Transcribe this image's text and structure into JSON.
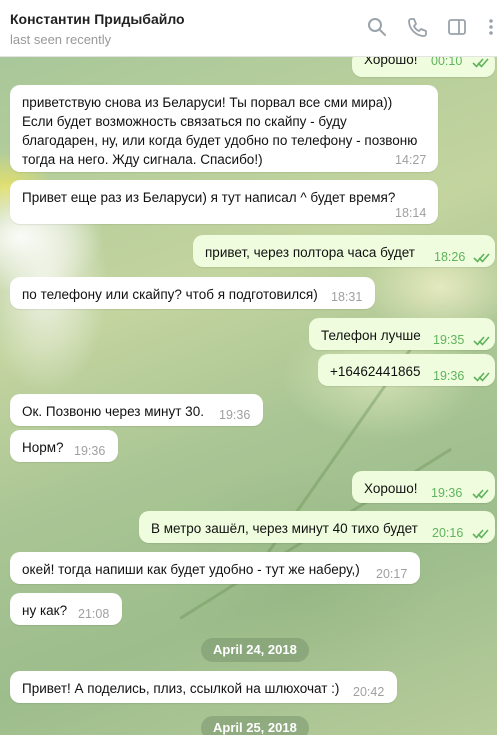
{
  "header": {
    "contact_name": "Константин Придыбайло",
    "last_seen": "last seen recently",
    "icons": [
      "search-icon",
      "phone-icon",
      "sidebar-icon",
      "more-icon"
    ]
  },
  "messages": [
    {
      "dir": "out",
      "text": "Хорошо!",
      "time": "00:10",
      "read": true
    },
    {
      "dir": "in",
      "text": "приветствую снова из Беларуси! Ты порвал все сми мира)) Если будет возможность связаться по скайпу - буду благодарен, ну, или когда будет удобно по телефону - позвоню тогда на него. Жду сигнала. Спасибо!)",
      "time": "14:27"
    },
    {
      "dir": "in",
      "text": "Привет еще раз из Беларуси) я тут написал ^ будет время?",
      "time": "18:14"
    },
    {
      "dir": "out",
      "text": "привет, через полтора часа будет",
      "time": "18:26",
      "read": true
    },
    {
      "dir": "in",
      "text": "по телефону или скайпу? чтоб я подготовился)",
      "time": "18:31"
    },
    {
      "dir": "out",
      "text": "Телефон лучше",
      "time": "19:35",
      "read": true
    },
    {
      "dir": "out",
      "text": "+16462441865",
      "time": "19:36",
      "read": true
    },
    {
      "dir": "in",
      "text": "Ок. Позвоню через минут 30.",
      "time": "19:36"
    },
    {
      "dir": "in",
      "text": "Норм?",
      "time": "19:36"
    },
    {
      "dir": "out",
      "text": "Хорошо!",
      "time": "19:36",
      "read": true
    },
    {
      "dir": "out",
      "text": "В метро зашёл, через минут 40 тихо будет",
      "time": "20:16",
      "read": true
    },
    {
      "dir": "in",
      "text": "окей! тогда напиши как будет удобно - тут же наберу,)",
      "time": "20:17"
    },
    {
      "dir": "in",
      "text": "ну как?",
      "time": "21:08"
    },
    {
      "dir": "in",
      "text": "Привет! А поделись, плиз, ссылкой на шлюхочат :)",
      "time": "20:42"
    }
  ],
  "dates": [
    "April 24, 2018",
    "April 25, 2018"
  ],
  "colors": {
    "incoming_bg": "#ffffff",
    "outgoing_bg": "#effdde",
    "outgoing_time": "#5fb35c",
    "read_check": "#5fb35c"
  }
}
